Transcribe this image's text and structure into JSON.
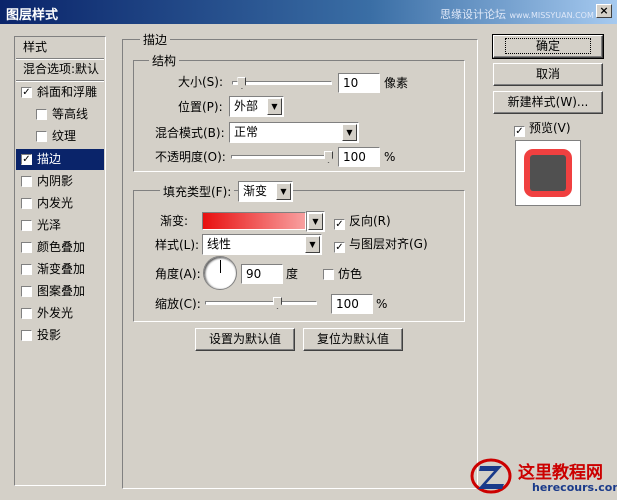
{
  "window": {
    "title": "图层样式",
    "watermark": "思缘设计论坛",
    "watermark_url": "www.MISSYUAN.COM",
    "close_glyph": "×"
  },
  "left_panel": {
    "header": "样式",
    "blend_options": "混合选项:默认",
    "items": [
      {
        "label": "斜面和浮雕",
        "checked": true,
        "check_glyph": "✓"
      },
      {
        "label": "等高线",
        "checked": false,
        "check_glyph": ""
      },
      {
        "label": "纹理",
        "checked": false,
        "check_glyph": ""
      },
      {
        "label": "描边",
        "checked": true,
        "check_glyph": "✓",
        "selected": true
      },
      {
        "label": "内阴影",
        "checked": false,
        "check_glyph": ""
      },
      {
        "label": "内发光",
        "checked": false,
        "check_glyph": ""
      },
      {
        "label": "光泽",
        "checked": false,
        "check_glyph": ""
      },
      {
        "label": "颜色叠加",
        "checked": false,
        "check_glyph": ""
      },
      {
        "label": "渐变叠加",
        "checked": false,
        "check_glyph": ""
      },
      {
        "label": "图案叠加",
        "checked": false,
        "check_glyph": ""
      },
      {
        "label": "外发光",
        "checked": false,
        "check_glyph": ""
      },
      {
        "label": "投影",
        "checked": false,
        "check_glyph": ""
      }
    ]
  },
  "stroke": {
    "group_title": "描边",
    "structure_title": "结构",
    "size_label": "大小(S):",
    "size_value": "10",
    "size_unit": "像素",
    "size_slider_fraction": 0.06,
    "position_label": "位置(P):",
    "position_value": "外部",
    "blend_label": "混合模式(B):",
    "blend_value": "正常",
    "opacity_label": "不透明度(O):",
    "opacity_value": "100",
    "opacity_unit": "%",
    "opacity_slider_fraction": 1.0
  },
  "fill": {
    "type_label": "填充类型(F):",
    "type_value": "渐变",
    "gradient_label": "渐变:",
    "gradient_colors": [
      "#e81010",
      "#f8a0a0"
    ],
    "reverse_label": "反向(R)",
    "reverse_checked": "✓",
    "style_label": "样式(L):",
    "style_value": "线性",
    "align_label": "与图层对齐(G)",
    "align_checked": "✓",
    "angle_label": "角度(A):",
    "angle_value": "90",
    "angle_unit": "度",
    "dither_label": "仿色",
    "dither_checked": "",
    "scale_label": "缩放(C):",
    "scale_value": "100",
    "scale_unit": "%",
    "scale_slider_fraction": 0.66
  },
  "buttons": {
    "set_default": "设置为默认值",
    "reset_default": "复位为默认值",
    "ok": "确定",
    "cancel": "取消",
    "new_style": "新建样式(W)...",
    "preview_label": "预览(V)",
    "preview_checked": "✓"
  },
  "preview": {
    "stroke_color": "#f04040",
    "fill_color": "#505050"
  },
  "logo": {
    "name": "这里教程网",
    "site": "herecours.com"
  },
  "colors": {
    "dialog_bg": "#d4d0c8",
    "title_bar": "#0a246a",
    "selection": "#0a246a"
  }
}
